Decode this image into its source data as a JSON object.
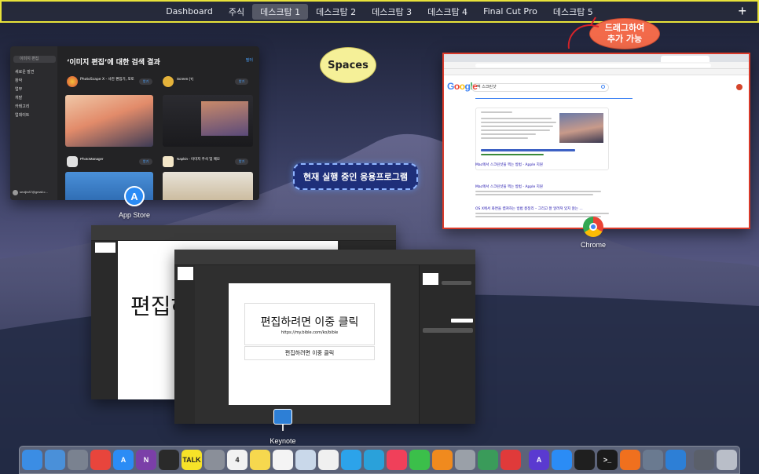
{
  "spaces_bar": {
    "spaces": [
      "Dashboard",
      "주식",
      "데스크탑 1",
      "데스크탑 2",
      "데스크탑 3",
      "데스크탑 4",
      "Final Cut Pro",
      "데스크탑 5"
    ],
    "active_index": 2,
    "add_label": "+"
  },
  "callouts": {
    "spaces": "Spaces",
    "drag_line1": "드래그하여",
    "drag_line2": "추가 가능",
    "running_apps": "현재 실행 중인 응용프로그램"
  },
  "appstore_window": {
    "app_label": "App Store",
    "search_title": "‘이미지 편집’에 대한 검색 결과",
    "search_field": "이미지 편집",
    "nav": [
      "새로운 발견",
      "창작",
      "업무",
      "개발",
      "카테고리",
      "업데이트"
    ],
    "filter": "필터",
    "results": [
      {
        "name": "PhotoScape X - 사진 편집기, 포토",
        "button": "받기"
      },
      {
        "name": "Screen (T)",
        "button": "받기"
      },
      {
        "name": "PhotoManager",
        "button": "받기"
      },
      {
        "name": "Napkin - 이미지 주석 및 메모",
        "button": "받기"
      }
    ],
    "account": "seoljin87@gmail.c..."
  },
  "chrome_window": {
    "app_label": "Chrome",
    "search_query": "맥 스크린샷",
    "logo": "Google",
    "result_links": [
      "Mac에서 스크린샷을 찍는 방법 - Apple 지원",
      "Mac에서 스크린샷을 찍는 방법 - Apple 지원",
      "OS X에서 화면을 캡쳐하는 방법 총정리 – 그리고 잘 알려져 있지 않는 ..."
    ]
  },
  "keynote_windows": {
    "app_label": "Keynote",
    "back_slide_text": "편집하",
    "front_slide_title": "편집하려면 이중 클릭",
    "front_slide_url": "https://my.bible.com/ko/bible",
    "front_slide_subtitle": "편집하려면 이중 클릭"
  },
  "dock": {
    "items": [
      {
        "name": "finder-icon",
        "color": "#3b8de4",
        "glyph": ""
      },
      {
        "name": "folder-icon",
        "color": "#4a90d9",
        "glyph": ""
      },
      {
        "name": "launchpad-icon",
        "color": "#7a8290",
        "glyph": ""
      },
      {
        "name": "chrome-icon",
        "color": "#e8453c",
        "glyph": ""
      },
      {
        "name": "app-store-icon",
        "color": "#2b8cf5",
        "glyph": "A"
      },
      {
        "name": "onenote-icon",
        "color": "#7b3fa8",
        "glyph": "N"
      },
      {
        "name": "final-cut-pro-icon",
        "color": "#2a2a2a",
        "glyph": ""
      },
      {
        "name": "kakaotalk-icon",
        "color": "#f7e328",
        "glyph": "TALK"
      },
      {
        "name": "system-preferences-icon",
        "color": "#8a8f99",
        "glyph": ""
      },
      {
        "name": "calendar-icon",
        "color": "#f2f2f2",
        "glyph": "4"
      },
      {
        "name": "notes-icon",
        "color": "#f6d84e",
        "glyph": ""
      },
      {
        "name": "reminders-icon",
        "color": "#f4f4f4",
        "glyph": ""
      },
      {
        "name": "preview-icon",
        "color": "#c9d8ea",
        "glyph": ""
      },
      {
        "name": "photos-icon",
        "color": "#f0f0f0",
        "glyph": ""
      },
      {
        "name": "messages-icon",
        "color": "#2ca3ea",
        "glyph": ""
      },
      {
        "name": "telegram-icon",
        "color": "#2aa1da",
        "glyph": ""
      },
      {
        "name": "music-icon",
        "color": "#f0405a",
        "glyph": ""
      },
      {
        "name": "facetime-icon",
        "color": "#3bbf4a",
        "glyph": ""
      },
      {
        "name": "books-icon",
        "color": "#f08a1e",
        "glyph": ""
      },
      {
        "name": "utility-icon",
        "color": "#9aa0a8",
        "glyph": ""
      },
      {
        "name": "network-icon",
        "color": "#3a9b5a",
        "glyph": ""
      },
      {
        "name": "video-icon",
        "color": "#e03a3a",
        "glyph": ""
      },
      {
        "name": "sep",
        "color": "",
        "glyph": ""
      },
      {
        "name": "affinity-icon",
        "color": "#5a3ad0",
        "glyph": "A"
      },
      {
        "name": "safari-icon",
        "color": "#2b8cf5",
        "glyph": ""
      },
      {
        "name": "stocks-icon",
        "color": "#1f1f1f",
        "glyph": ""
      },
      {
        "name": "terminal-icon",
        "color": "#1b1b1b",
        "glyph": ">_"
      },
      {
        "name": "firefox-icon",
        "color": "#f0701e",
        "glyph": ""
      },
      {
        "name": "photo-browser-icon",
        "color": "#6a7a90",
        "glyph": ""
      },
      {
        "name": "keynote-icon",
        "color": "#2d7fd6",
        "glyph": ""
      },
      {
        "name": "sep",
        "color": "",
        "glyph": ""
      },
      {
        "name": "screenshot-icon",
        "color": "#5a5f6a",
        "glyph": ""
      },
      {
        "name": "trash-icon",
        "color": "#b9bec8",
        "glyph": ""
      }
    ]
  }
}
